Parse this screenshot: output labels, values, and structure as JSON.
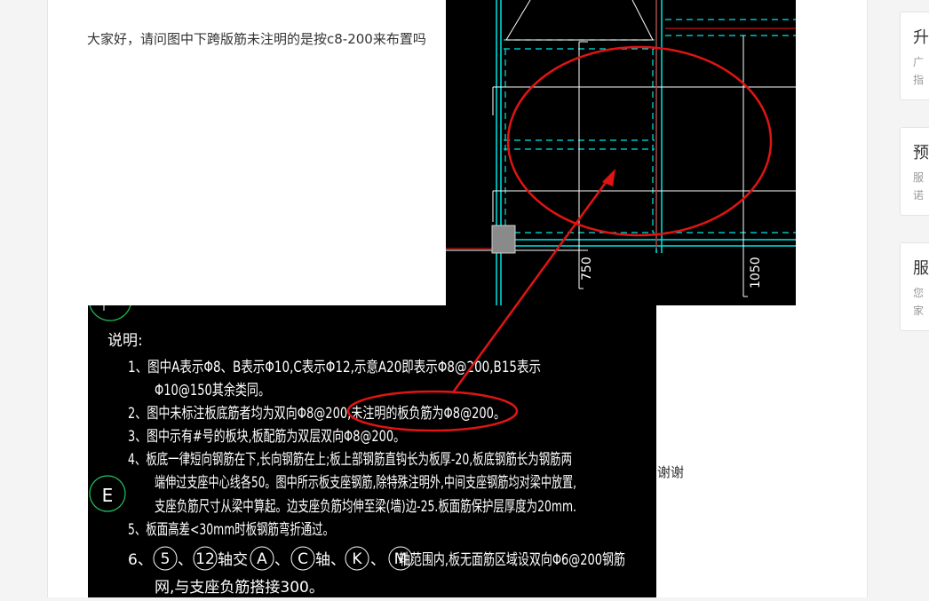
{
  "post": {
    "question": "大家好，请问图中下跨版筋未注明的是按c8-200来布置吗",
    "thanks": "谢谢"
  },
  "drawing": {
    "dim_750": "750",
    "dim_1050": "1050",
    "axis_E": "E",
    "notes_title": "说明:",
    "notes": [
      "1、图中A表示Φ8、B表示Φ10,C表示Φ12,示意A20即表示Φ8@200,B15表示",
      "Φ10@150其余类同。",
      "2、图中未标注板底筋者均为双向Φ8@200,未注明的板负筋为Φ8@200。",
      "3、图中示有#号的板块,板配筋为双层双向Φ8@200。",
      "4、板底一律短向钢筋在下,长向钢筋在上;板上部钢筋直钩长为板厚-20,板底钢筋长为钢筋两",
      "端伸过支座中心线各50。图中所示板支座钢筋,除特殊注明外,中间支座钢筋均对梁中放置,",
      "支座负筋尺寸从梁中算起。边支座负筋均伸至梁(墙)边-25.板面筋保护层厚度为20mm.",
      "5、板面高差<30mm时板钢筋弯折通过。",
      "6、",
      "网,与支座负筋搭接300。"
    ],
    "note6_parts": {
      "sep1": "、",
      "jiao": "轴交",
      "sep2": "、",
      "zhou": "轴、",
      "sep3": "、",
      "rest": "轴范围内,板无面筋区域设双向Φ6@200钢筋"
    },
    "axis_bubbles": [
      "5",
      "12",
      "A",
      "C",
      "K",
      "M"
    ]
  },
  "sidebar": {
    "cards": [
      {
        "title": "升",
        "desc": "广指"
      },
      {
        "title": "预",
        "desc": "服诺"
      },
      {
        "title": "服",
        "desc": "您家"
      }
    ]
  },
  "colors": {
    "annotation_red": "#e01414",
    "cad_cyan": "#00e5e5",
    "cad_green": "#22c55e",
    "cad_background": "#000000"
  }
}
